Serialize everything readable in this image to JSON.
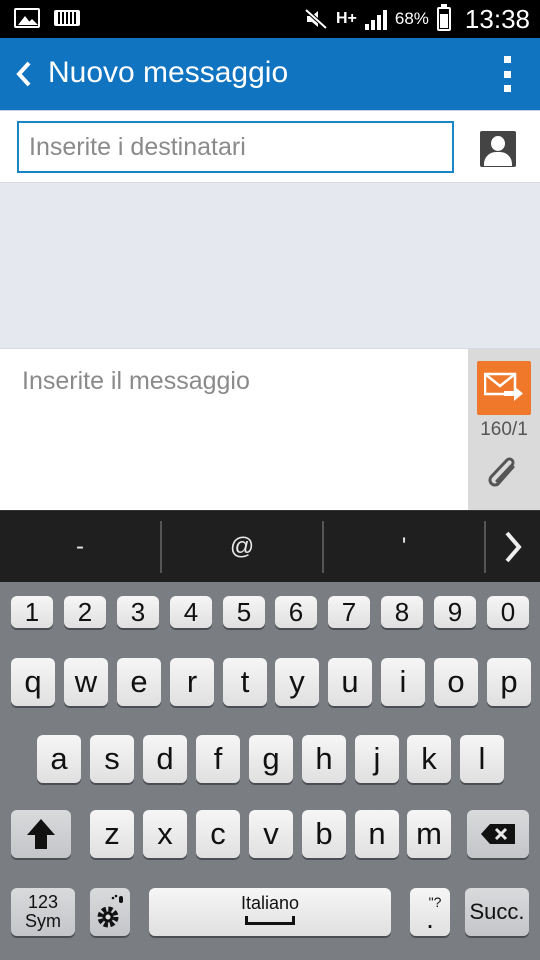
{
  "status_bar": {
    "battery": "68%",
    "battery_level": 0.68,
    "network": "H+",
    "time": "13:38",
    "icons": [
      "picture-icon",
      "keyboard-icon",
      "mute-icon",
      "network-hplus-icon",
      "signal-icon",
      "battery-icon"
    ]
  },
  "app_bar": {
    "title": "Nuovo messaggio",
    "back_icon": "chevron-left-icon",
    "menu_icon": "more-vertical-icon",
    "color": "#1074c1"
  },
  "recipient": {
    "placeholder": "Inserite i destinatari",
    "value": "",
    "contact_icon": "contact-icon"
  },
  "compose": {
    "placeholder": "Inserite il messaggio",
    "value": "",
    "counter": "160/1",
    "send_icon": "send-message-icon",
    "attach_icon": "paperclip-icon",
    "send_color": "#f0782a"
  },
  "suggestions": {
    "items": [
      "-",
      "@",
      "'"
    ],
    "more_icon": "chevron-right-icon"
  },
  "keyboard": {
    "numbers": [
      "1",
      "2",
      "3",
      "4",
      "5",
      "6",
      "7",
      "8",
      "9",
      "0"
    ],
    "row1": [
      "q",
      "w",
      "e",
      "r",
      "t",
      "y",
      "u",
      "i",
      "o",
      "p"
    ],
    "row2": [
      "a",
      "s",
      "d",
      "f",
      "g",
      "h",
      "j",
      "k",
      "l"
    ],
    "row3": [
      "z",
      "x",
      "c",
      "v",
      "b",
      "n",
      "m"
    ],
    "shift_icon": "shift-arrow-icon",
    "backspace_icon": "backspace-icon",
    "sym_line1": "123",
    "sym_line2": "Sym",
    "settings_icon": "settings-gear-icon",
    "space_label": "Italiano",
    "period": ".",
    "period_secondary": "\"?",
    "enter_label": "Succ."
  }
}
